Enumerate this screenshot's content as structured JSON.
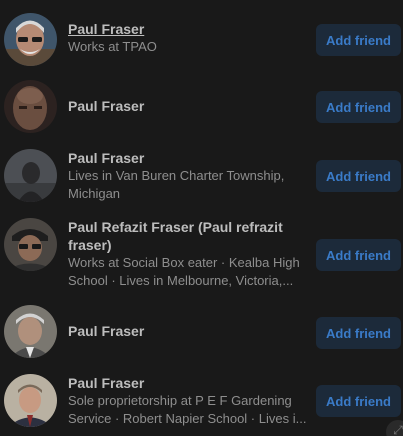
{
  "results": [
    {
      "name": "Paul Fraser",
      "details": "Works at TPAO",
      "button": "Add friend"
    },
    {
      "name": "Paul Fraser",
      "details": "",
      "button": "Add friend"
    },
    {
      "name": "Paul Fraser",
      "details": "Lives in Van Buren Charter Township, Michigan",
      "button": "Add friend"
    },
    {
      "name": "Paul Refazit Fraser (Paul refrazit fraser)",
      "details": "Works at Social Box eater · Kealba High School · Lives in Melbourne, Victoria,...",
      "button": "Add friend"
    },
    {
      "name": "Paul Fraser",
      "details": "",
      "button": "Add friend"
    },
    {
      "name": "Paul Fraser",
      "details": "Sole proprietorship at P E F Gardening Service · Robert Napier School · Lives i...",
      "button": "Add friend"
    }
  ],
  "colors": {
    "background": "#191919",
    "name_text": "#bdbdbd",
    "secondary_text": "#8e8e8e",
    "button_bg": "#1c2a3a",
    "button_text": "#3a7bc8"
  },
  "icons": {
    "corner": "expand-icon"
  }
}
